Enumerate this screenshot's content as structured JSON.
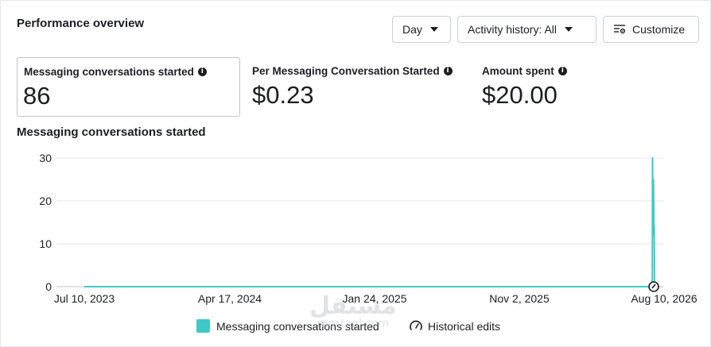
{
  "header": {
    "title": "Performance overview",
    "buttons": {
      "day": "Day",
      "activity": "Activity history: All",
      "customize": "Customize"
    }
  },
  "metrics": [
    {
      "label": "Messaging conversations started",
      "value": "86",
      "selected": true
    },
    {
      "label": "Per Messaging Conversation Started",
      "value": "$0.23",
      "selected": false
    },
    {
      "label": "Amount spent",
      "value": "$20.00",
      "selected": false
    }
  ],
  "chart_data": {
    "type": "line",
    "title": "Messaging conversations started",
    "x_ticks": [
      "Jul 10, 2023",
      "Apr 17, 2024",
      "Jan 24, 2025",
      "Nov 2, 2025",
      "Aug 10, 2026"
    ],
    "y_ticks": [
      "30",
      "20",
      "10",
      "0"
    ],
    "ylim": [
      0,
      30
    ],
    "grid": true,
    "series": [
      {
        "name": "Messaging conversations started",
        "color": "#3ec9c6",
        "x": [
          "2023-07-10",
          "2026-08-02",
          "2026-08-03",
          "2026-08-04",
          "2026-08-05",
          "2026-08-06",
          "2026-08-07",
          "2026-08-08",
          "2026-08-09",
          "2026-08-10"
        ],
        "values": [
          0,
          0,
          30,
          20,
          12,
          25,
          18,
          12,
          14,
          0
        ]
      }
    ],
    "legend": [
      "Messaging conversations started",
      "Historical edits"
    ],
    "legend_position": "bottom"
  },
  "watermark": {
    "arabic": "مستقل",
    "latin": "mostaql.com"
  }
}
